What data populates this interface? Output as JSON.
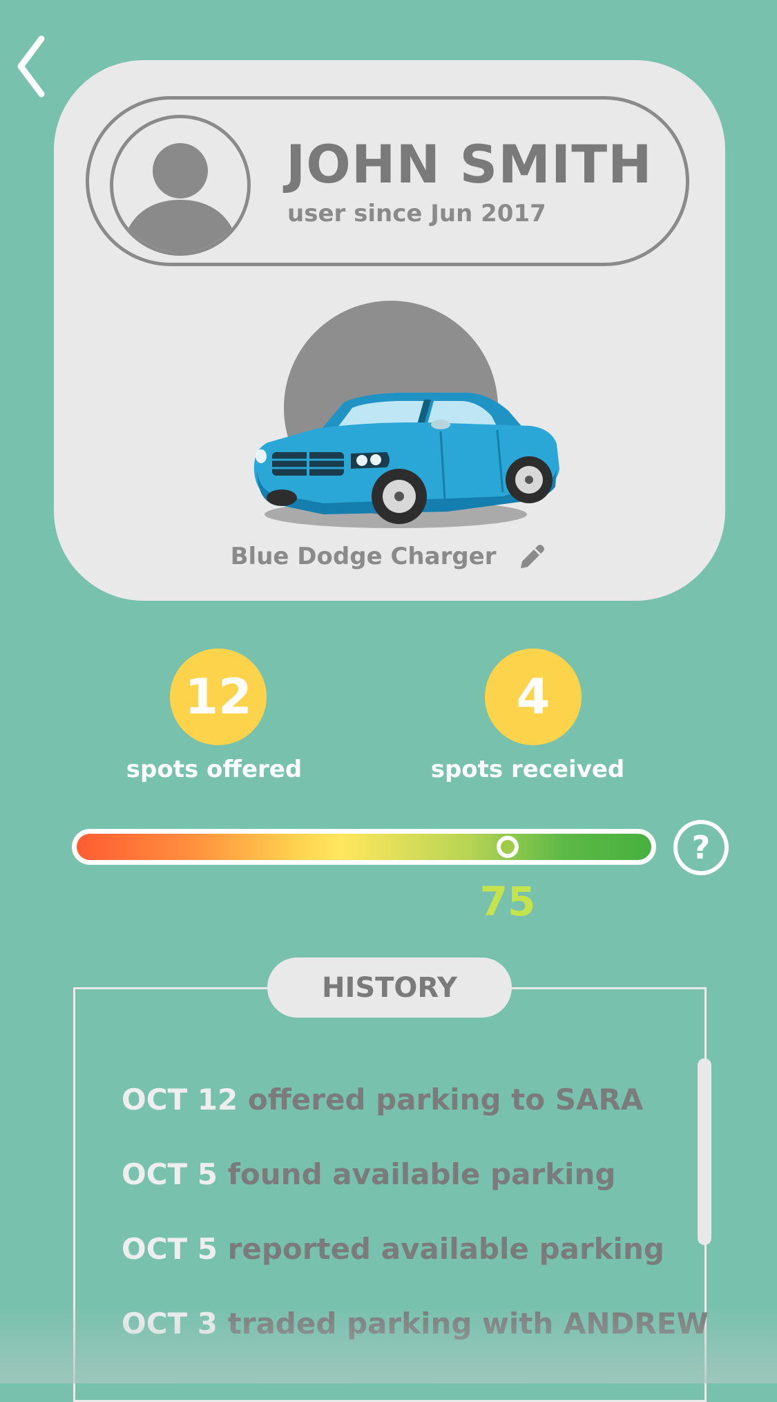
{
  "nav": {
    "back_icon": "chevron-left-icon"
  },
  "profile": {
    "name": "JOHN SMITH",
    "since": "user since Jun 2017",
    "avatar_icon": "user-silhouette-icon"
  },
  "car": {
    "name": "Blue Dodge Charger",
    "edit_icon": "pencil-icon",
    "car_color": "#2aa7d6"
  },
  "stats": {
    "offered": {
      "value": "12",
      "label": "spots offered"
    },
    "received": {
      "value": "4",
      "label": "spots received"
    }
  },
  "rating": {
    "value": "75",
    "fraction": 0.75,
    "help_label": "?"
  },
  "history": {
    "title": "HISTORY",
    "items": [
      {
        "date": "OCT 12",
        "text": "offered parking to SARA"
      },
      {
        "date": "OCT 5",
        "text": "found available parking"
      },
      {
        "date": "OCT 5",
        "text": "reported available parking"
      },
      {
        "date": "OCT 3",
        "text": "traded parking with ANDREW"
      }
    ]
  },
  "colors": {
    "background": "#78c1ad",
    "card": "#e9e9e9",
    "stat_circle": "#fdd34c",
    "rating_value": "#c4e34c"
  }
}
